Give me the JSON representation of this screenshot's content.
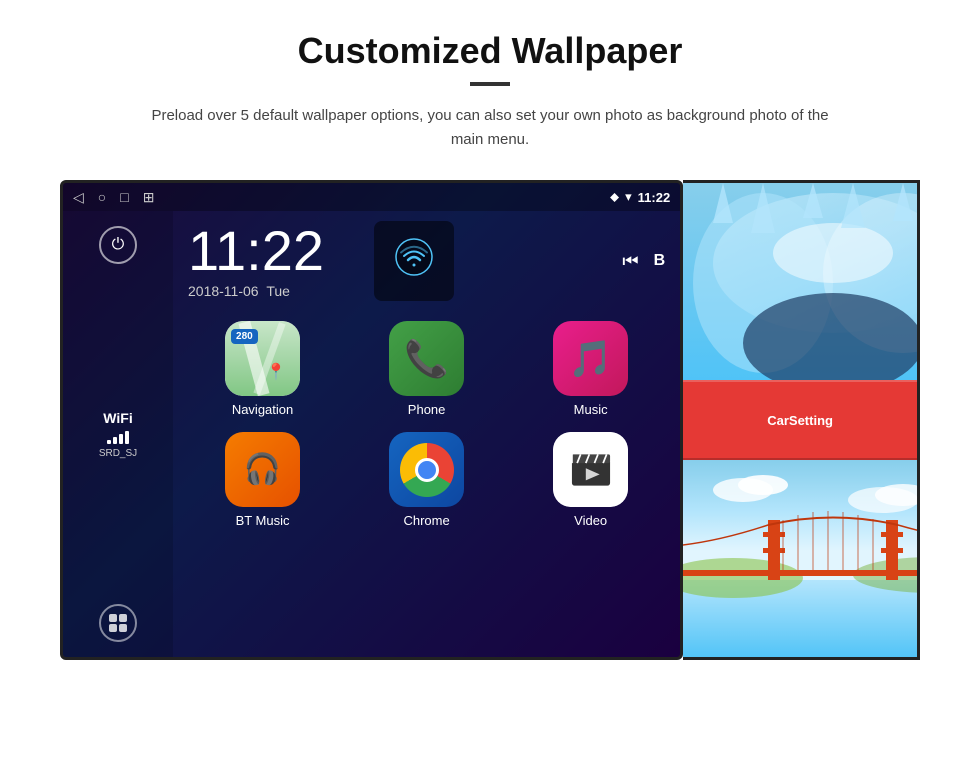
{
  "page": {
    "title": "Customized Wallpaper",
    "subtitle": "Preload over 5 default wallpaper options, you can also set your own photo as background photo of the main menu."
  },
  "statusBar": {
    "time": "11:22",
    "navIcons": [
      "◁",
      "○",
      "□",
      "⊞"
    ],
    "rightIcons": [
      "location",
      "wifi",
      "time"
    ]
  },
  "clock": {
    "time": "11:22",
    "date": "2018-11-06",
    "day": "Tue"
  },
  "wifi": {
    "label": "WiFi",
    "network": "SRD_SJ"
  },
  "apps": [
    {
      "name": "Navigation",
      "type": "navigation"
    },
    {
      "name": "Phone",
      "type": "phone"
    },
    {
      "name": "Music",
      "type": "music"
    },
    {
      "name": "BT Music",
      "type": "bt-music"
    },
    {
      "name": "Chrome",
      "type": "chrome"
    },
    {
      "name": "Video",
      "type": "video"
    }
  ],
  "wallpapers": [
    {
      "name": "ice-cave",
      "label": "Ice Cave"
    },
    {
      "name": "bridge",
      "label": "Golden Gate Bridge"
    }
  ],
  "carsetting": {
    "label": "CarSetting"
  },
  "navBadge": "280"
}
